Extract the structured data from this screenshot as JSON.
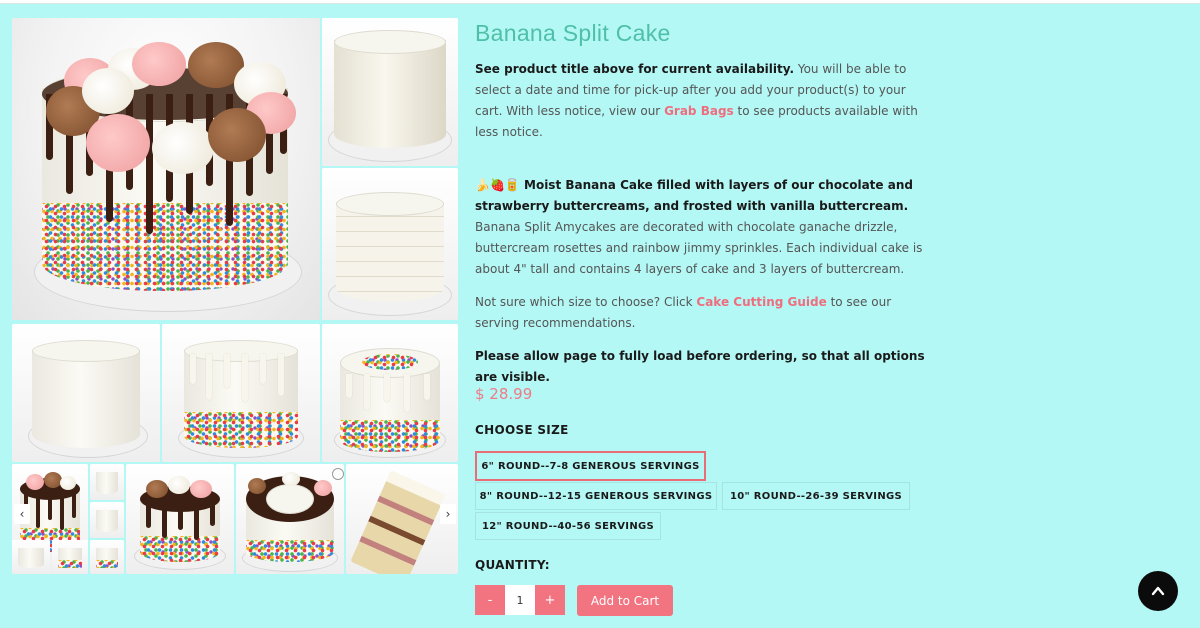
{
  "product": {
    "title": "Banana Split Cake",
    "availability_bold": "See product title above for current availability.",
    "availability_text": "  You will be able to select a date and time for pick-up after you add your product(s) to your cart.   With less notice, view our ",
    "grab_bags_link": "Grab Bags",
    "availability_tail": " to see products available with less notice.",
    "emojis": "🍌🍓🥫",
    "description_bold": " Moist Banana Cake filled with layers of our chocolate and strawberry buttercreams, and frosted with vanilla buttercream.",
    "description_text": " Banana Split Amycakes are decorated with chocolate ganache drizzle, buttercream rosettes and rainbow jimmy sprinkles.  Each individual cake is about 4\" tall and contains 4 layers of cake and 3 layers of buttercream.",
    "size_help_text": "Not sure which size to choose?  Click ",
    "cutting_guide_link": "Cake Cutting Guide",
    "size_help_tail": " to see our serving recommendations.",
    "load_notice": "Please allow page to fully load before ordering, so that all options are visible.",
    "price": "$ 28.99"
  },
  "size_selector": {
    "label": "CHOOSE SIZE",
    "options": [
      "6\" ROUND--7-8 GENEROUS SERVINGS",
      "8\" ROUND--12-15 GENEROUS SERVINGS",
      "10\" ROUND--26-39 SERVINGS",
      "12\" ROUND--40-56 SERVINGS"
    ],
    "selected_index": 0
  },
  "quantity": {
    "label": "QUANTITY:",
    "minus": "-",
    "plus": "+",
    "value": "1"
  },
  "cart_button": "Add to Cart",
  "carousel": {
    "prev": "‹",
    "next": "›"
  },
  "icons": {
    "back_to_top": "chevron-up-icon"
  },
  "colors": {
    "background": "#b3f8f5",
    "title": "#4fbfa8",
    "accent": "#f27480",
    "link": "#ef6e7e",
    "selected_border": "#e86d76"
  }
}
